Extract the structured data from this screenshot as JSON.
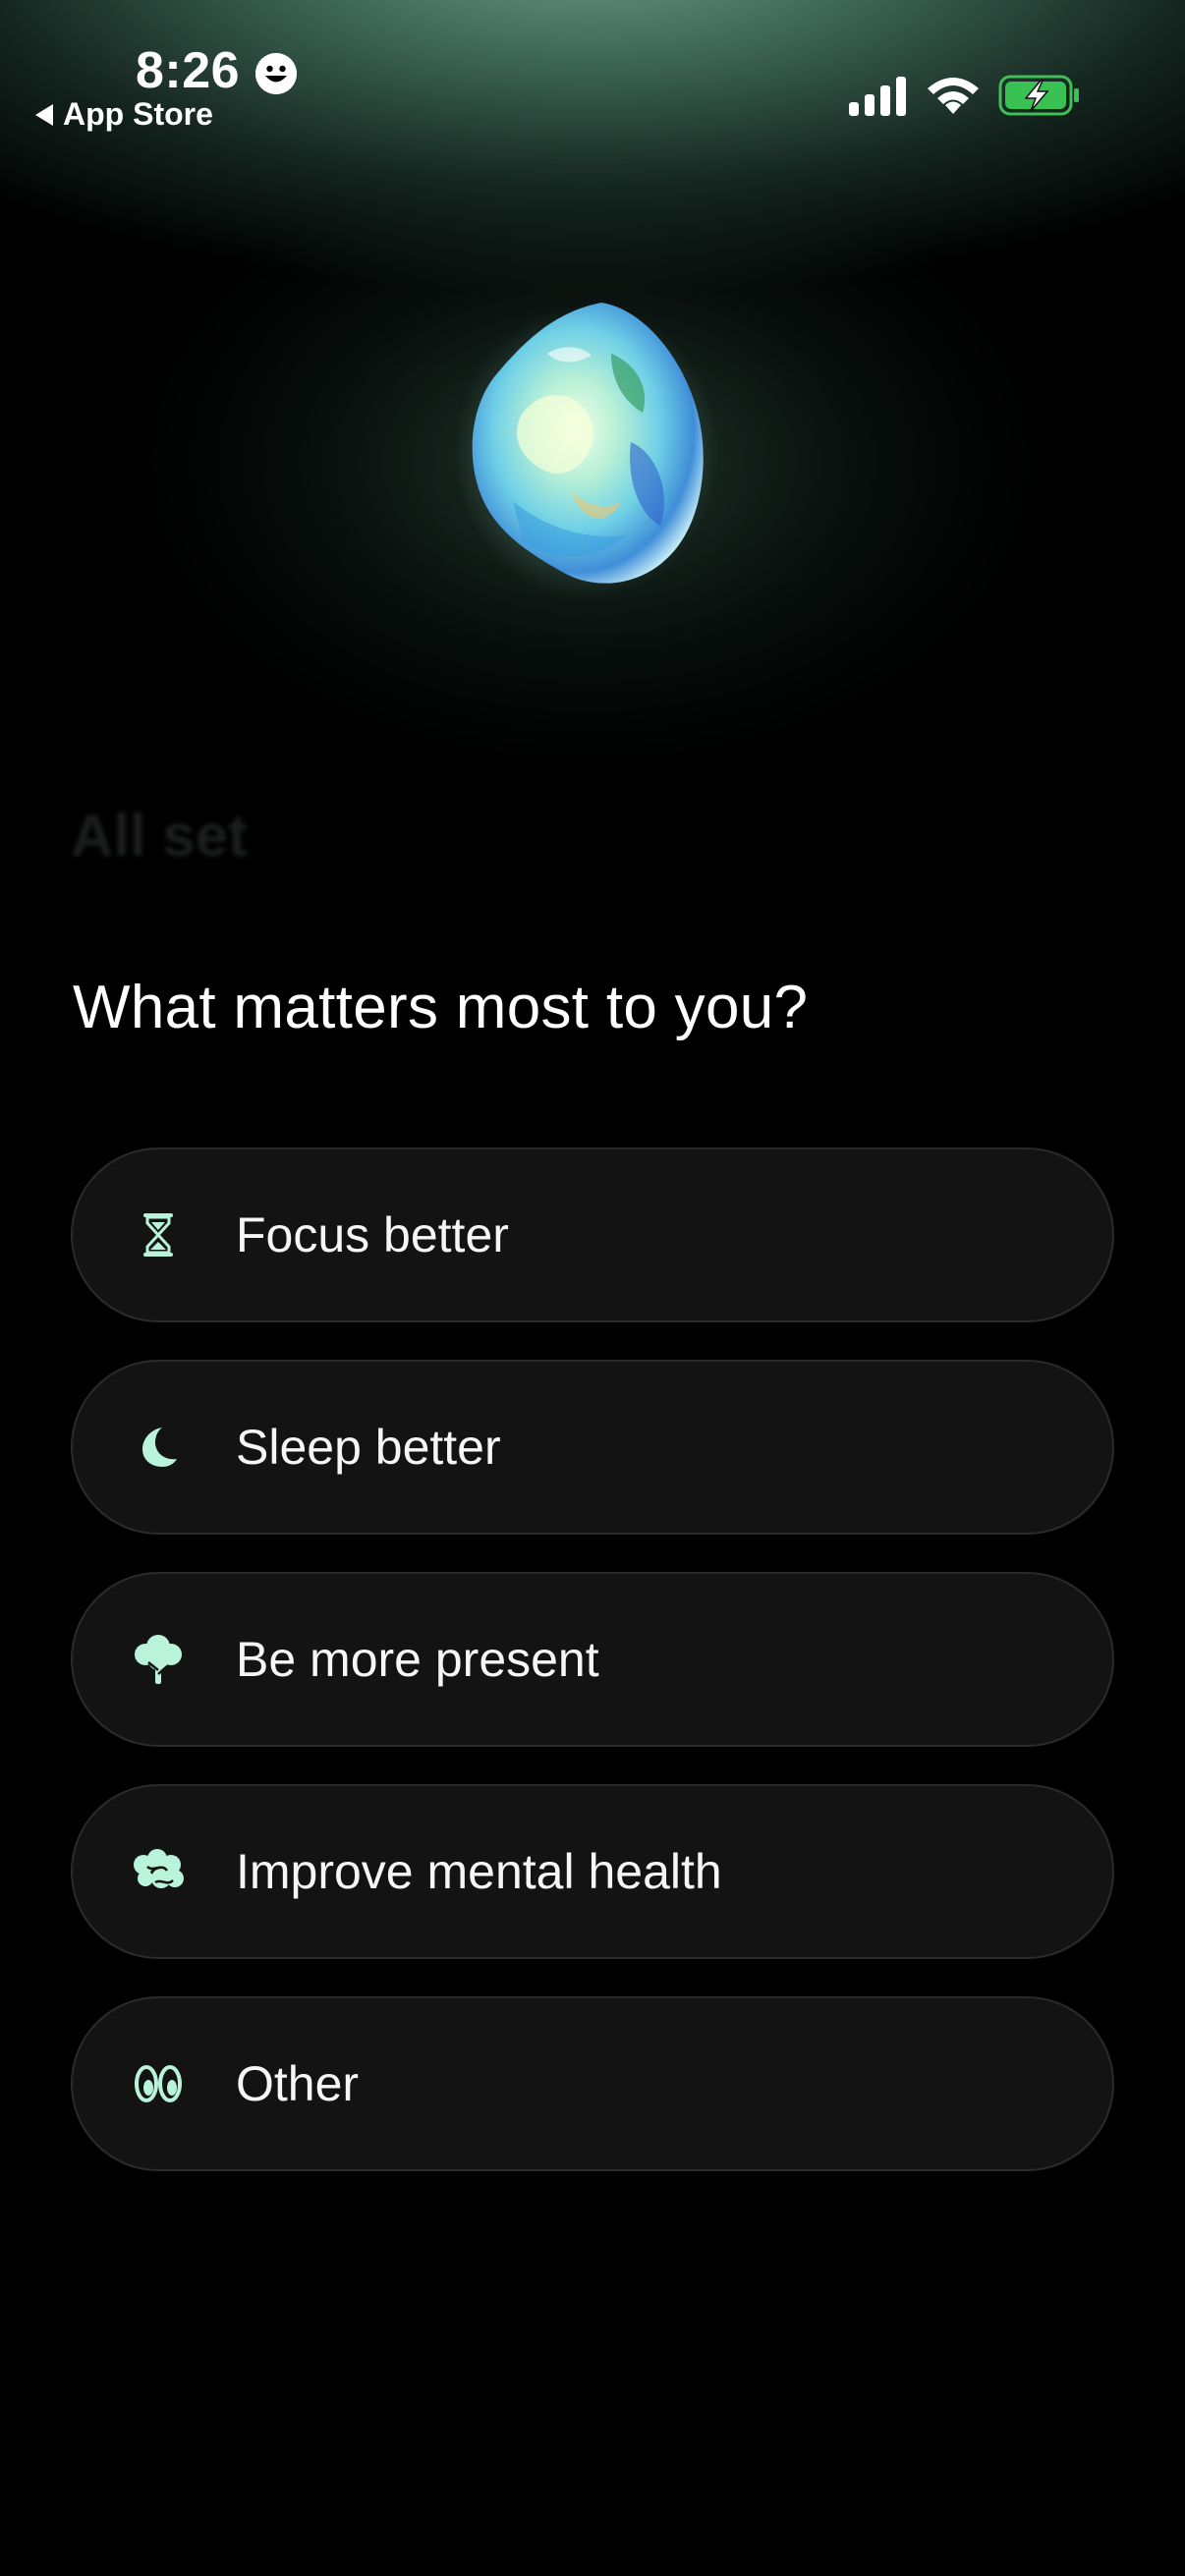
{
  "status_bar": {
    "time": "8:26",
    "back_label": "App Store"
  },
  "background_heading": "All set",
  "question": "What matters most to you?",
  "accent_color": "#b9f3d9",
  "options": [
    {
      "label": "Focus better",
      "icon": "hourglass-icon"
    },
    {
      "label": "Sleep better",
      "icon": "moon-icon"
    },
    {
      "label": "Be more present",
      "icon": "tree-icon"
    },
    {
      "label": "Improve mental health",
      "icon": "brain-icon"
    },
    {
      "label": "Other",
      "icon": "eyes-icon"
    }
  ]
}
